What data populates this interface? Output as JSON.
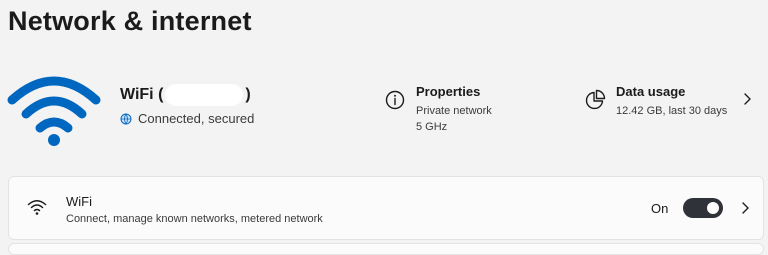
{
  "header": {
    "title": "Network & internet"
  },
  "hero": {
    "network_name_prefix": "WiFi (",
    "network_name_suffix": ")",
    "status": "Connected, secured",
    "icons": {
      "main": "wifi-signal-icon",
      "status": "globe-icon"
    },
    "accent_color": "#0067c0"
  },
  "properties": {
    "title": "Properties",
    "lines": [
      "Private network",
      "5 GHz"
    ],
    "icon": "info-icon"
  },
  "data_usage": {
    "title": "Data usage",
    "value": "12.42 GB, last 30 days",
    "icon": "pie-chart-icon"
  },
  "wifi_card": {
    "title": "WiFi",
    "subtitle": "Connect, manage known networks, metered network",
    "toggle_label": "On",
    "toggle_on": true,
    "icon": "wifi-icon"
  }
}
